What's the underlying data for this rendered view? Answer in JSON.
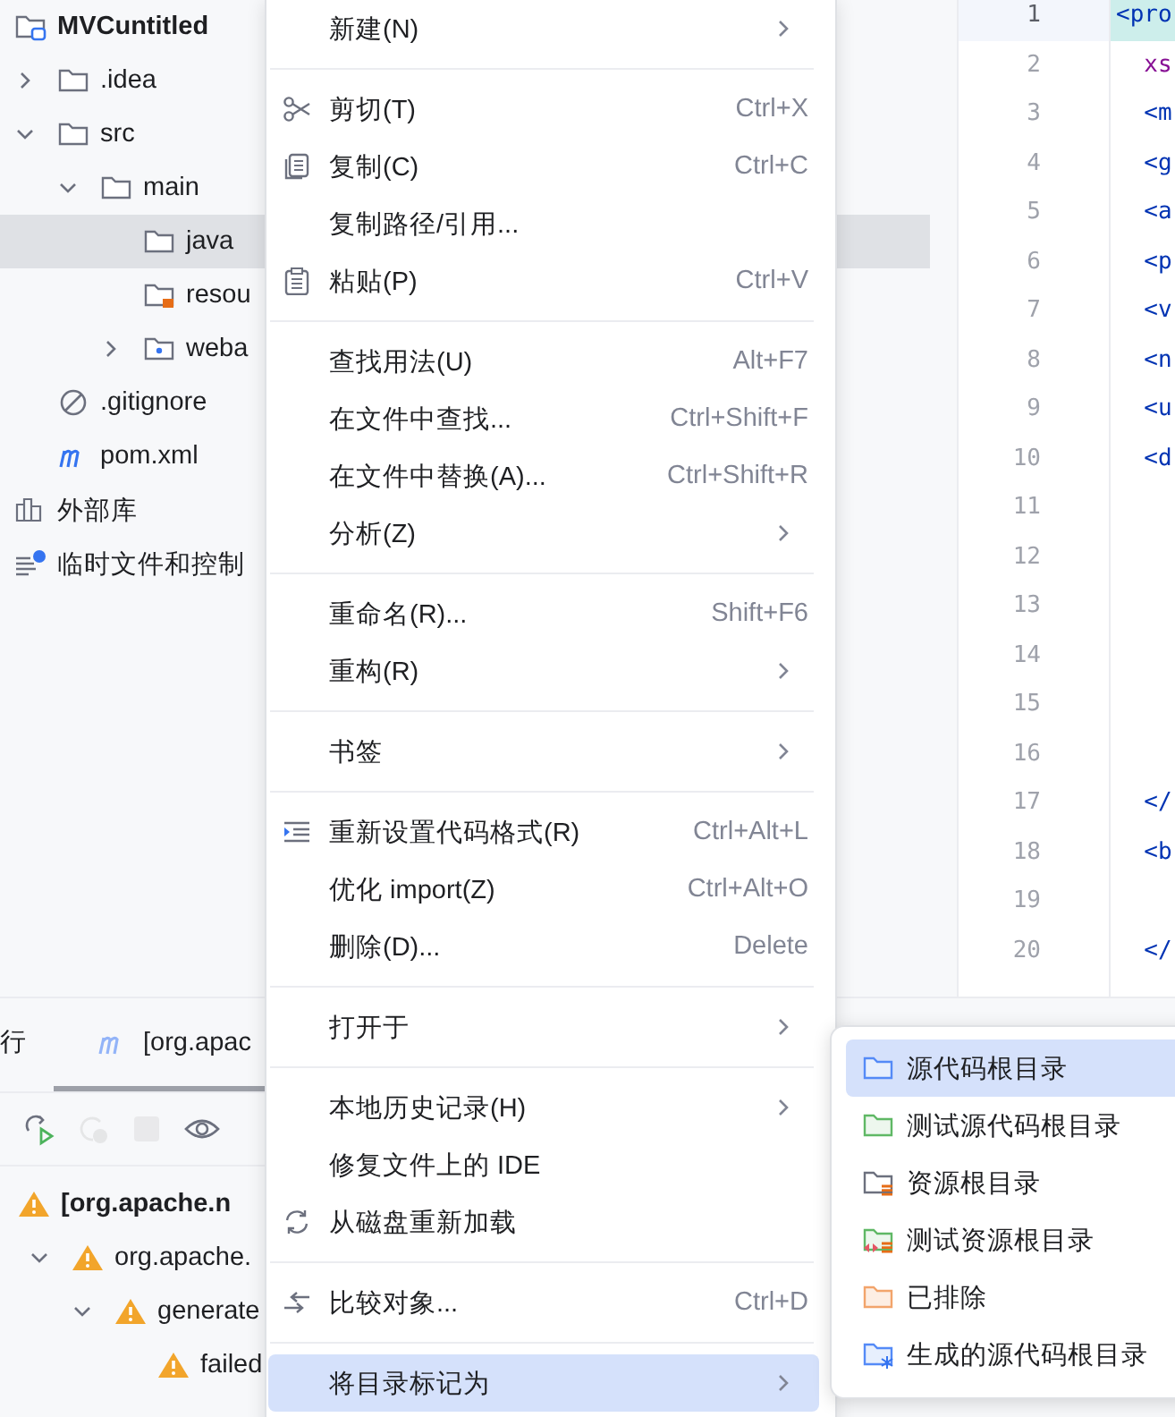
{
  "project_tree": [
    {
      "label": "MVCuntitled",
      "kind": "module",
      "selected": false,
      "children": [
        {
          "label": ".idea",
          "kind": "folder",
          "expanded": false,
          "selected": false
        },
        {
          "label": "src",
          "kind": "folder",
          "expanded": true,
          "selected": false,
          "children": [
            {
              "label": "main",
              "kind": "folder",
              "expanded": true,
              "selected": false,
              "children": [
                {
                  "label": "java",
                  "kind": "folder",
                  "selected": true
                },
                {
                  "label": "resou",
                  "kind": "resources",
                  "selected": false
                },
                {
                  "label": "weba",
                  "kind": "web",
                  "expanded": false,
                  "selected": false
                }
              ]
            }
          ]
        },
        {
          "label": ".gitignore",
          "kind": "ignore",
          "selected": false
        },
        {
          "label": "pom.xml",
          "kind": "maven",
          "selected": false
        }
      ]
    },
    {
      "label": "外部库",
      "kind": "libraries",
      "selected": false
    },
    {
      "label": "临时文件和控制",
      "kind": "scratches",
      "selected": false
    }
  ],
  "editor": {
    "lines": [
      {
        "number": "1",
        "code": "<pro",
        "kind": "tag",
        "current": true
      },
      {
        "number": "2",
        "code": "  xs",
        "kind": "attribute",
        "current": false
      },
      {
        "number": "3",
        "code": "  <m",
        "kind": "tag",
        "current": false
      },
      {
        "number": "4",
        "code": "  <g",
        "kind": "tag",
        "current": false
      },
      {
        "number": "5",
        "code": "  <a",
        "kind": "tag",
        "current": false
      },
      {
        "number": "6",
        "code": "  <p",
        "kind": "tag",
        "current": false
      },
      {
        "number": "7",
        "code": "  <v",
        "kind": "tag",
        "current": false
      },
      {
        "number": "8",
        "code": "  <n",
        "kind": "tag",
        "current": false
      },
      {
        "number": "9",
        "code": "  <u",
        "kind": "tag",
        "current": false
      },
      {
        "number": "10",
        "code": "  <d",
        "kind": "tag",
        "current": false
      },
      {
        "number": "11",
        "current": false
      },
      {
        "number": "12",
        "current": false
      },
      {
        "number": "13",
        "current": false
      },
      {
        "number": "14",
        "current": false
      },
      {
        "number": "15",
        "current": false
      },
      {
        "number": "16",
        "current": false
      },
      {
        "number": "17",
        "code": "  </",
        "kind": "tag",
        "current": false
      },
      {
        "number": "18",
        "code": "  <b",
        "kind": "tag",
        "current": false
      },
      {
        "number": "19",
        "current": false
      },
      {
        "number": "20",
        "code": "  </",
        "kind": "tag",
        "current": false
      }
    ]
  },
  "bottom_panel": {
    "tabs": [
      {
        "label": "行",
        "kind": "plain",
        "selected": false
      },
      {
        "label": "[org.apac",
        "kind": "maven",
        "selected": true
      }
    ],
    "toolbar": [
      {
        "kind": "rerun",
        "disabled": false
      },
      {
        "kind": "rerun-failed",
        "disabled": true
      },
      {
        "kind": "stop",
        "disabled": true
      },
      {
        "kind": "view",
        "disabled": false
      }
    ],
    "run_tree": [
      {
        "label": "[org.apache.n",
        "bold": true,
        "children": [
          {
            "label": "org.apache.",
            "bold": false,
            "expanded": true,
            "children": [
              {
                "label": "generate",
                "bold": false,
                "expanded": true,
                "children": [
                  {
                    "label": "failed",
                    "bold": false
                  }
                ]
              }
            ]
          }
        ]
      }
    ]
  },
  "context_menu": {
    "sections": [
      [
        {
          "label": "新建(N)",
          "kind": "plain",
          "submenu": true,
          "selected": false
        }
      ],
      [
        {
          "label": "剪切(T)",
          "kind": "cut",
          "shortcut": "Ctrl+X",
          "submenu": false,
          "selected": false
        },
        {
          "label": "复制(C)",
          "kind": "copy",
          "shortcut": "Ctrl+C",
          "submenu": false,
          "selected": false
        },
        {
          "label": "复制路径/引用...",
          "kind": "plain",
          "submenu": false,
          "selected": false
        },
        {
          "label": "粘贴(P)",
          "kind": "paste",
          "shortcut": "Ctrl+V",
          "submenu": false,
          "selected": false
        }
      ],
      [
        {
          "label": "查找用法(U)",
          "kind": "plain",
          "shortcut": "Alt+F7",
          "submenu": false,
          "selected": false
        },
        {
          "label": "在文件中查找...",
          "kind": "plain",
          "shortcut": "Ctrl+Shift+F",
          "submenu": false,
          "selected": false
        },
        {
          "label": "在文件中替换(A)...",
          "kind": "plain",
          "shortcut": "Ctrl+Shift+R",
          "submenu": false,
          "selected": false
        },
        {
          "label": "分析(Z)",
          "kind": "plain",
          "submenu": true,
          "selected": false
        }
      ],
      [
        {
          "label": "重命名(R)...",
          "kind": "plain",
          "shortcut": "Shift+F6",
          "submenu": false,
          "selected": false
        },
        {
          "label": "重构(R)",
          "kind": "plain",
          "submenu": true,
          "selected": false
        }
      ],
      [
        {
          "label": "书签",
          "kind": "plain",
          "submenu": true,
          "selected": false
        }
      ],
      [
        {
          "label": "重新设置代码格式(R)",
          "kind": "reformat",
          "shortcut": "Ctrl+Alt+L",
          "submenu": false,
          "selected": false
        },
        {
          "label": "优化 import(Z)",
          "kind": "plain",
          "shortcut": "Ctrl+Alt+O",
          "submenu": false,
          "selected": false
        },
        {
          "label": "删除(D)...",
          "kind": "plain",
          "shortcut": "Delete",
          "submenu": false,
          "selected": false
        }
      ],
      [
        {
          "label": "打开于",
          "kind": "plain",
          "submenu": true,
          "selected": false
        }
      ],
      [
        {
          "label": "本地历史记录(H)",
          "kind": "plain",
          "submenu": true,
          "selected": false
        },
        {
          "label": "修复文件上的 IDE",
          "kind": "plain",
          "submenu": false,
          "selected": false
        },
        {
          "label": "从磁盘重新加载",
          "kind": "reload",
          "submenu": false,
          "selected": false
        }
      ],
      [
        {
          "label": "比较对象...",
          "kind": "compare",
          "shortcut": "Ctrl+D",
          "submenu": false,
          "selected": false
        }
      ],
      [
        {
          "label": "将目录标记为",
          "kind": "plain",
          "submenu": true,
          "selected": true
        }
      ]
    ]
  },
  "submenu": {
    "items": [
      {
        "label": "源代码根目录",
        "kind": "sources",
        "selected": true
      },
      {
        "label": "测试源代码根目录",
        "kind": "test-sources",
        "selected": false
      },
      {
        "label": "资源根目录",
        "kind": "resources",
        "selected": false
      },
      {
        "label": "测试资源根目录",
        "kind": "test-resources",
        "selected": false
      },
      {
        "label": "已排除",
        "kind": "excluded",
        "selected": false
      },
      {
        "label": "生成的源代码根目录",
        "kind": "generated",
        "selected": false
      }
    ]
  }
}
